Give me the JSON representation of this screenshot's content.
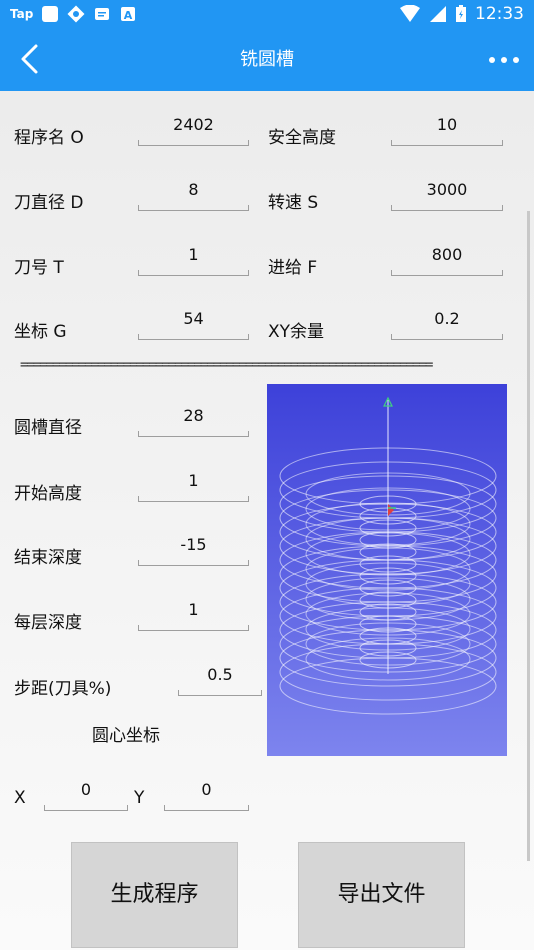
{
  "status_bar": {
    "app_label": "Tap",
    "time": "12:33"
  },
  "app_bar": {
    "title": "铣圆槽"
  },
  "params": [
    {
      "label": "程序名 O",
      "value": "2402"
    },
    {
      "label": "安全高度",
      "value": "10"
    },
    {
      "label": "刀直径 D",
      "value": "8"
    },
    {
      "label": "转速 S",
      "value": "3000"
    },
    {
      "label": "刀号 T",
      "value": "1"
    },
    {
      "label": "进给 F",
      "value": "800"
    },
    {
      "label": "坐标 G",
      "value": "54"
    },
    {
      "label": "XY余量",
      "value": "0.2"
    }
  ],
  "divider_text": "================================================================",
  "slot": [
    {
      "label": "圆槽直径",
      "value": "28"
    },
    {
      "label": "开始高度",
      "value": "1"
    },
    {
      "label": "结束深度",
      "value": "-15"
    },
    {
      "label": "每层深度",
      "value": "1"
    },
    {
      "label": "步距(刀具%)",
      "value": "0.5"
    }
  ],
  "center": {
    "heading": "圆心坐标",
    "x_label": "X",
    "x_value": "0",
    "y_label": "Y",
    "y_value": "0"
  },
  "buttons": {
    "generate": "生成程序",
    "export": "导出文件"
  },
  "colors": {
    "primary": "#2196F3",
    "preview_top": "#3d41d9",
    "preview_bottom": "#7d84ee"
  }
}
